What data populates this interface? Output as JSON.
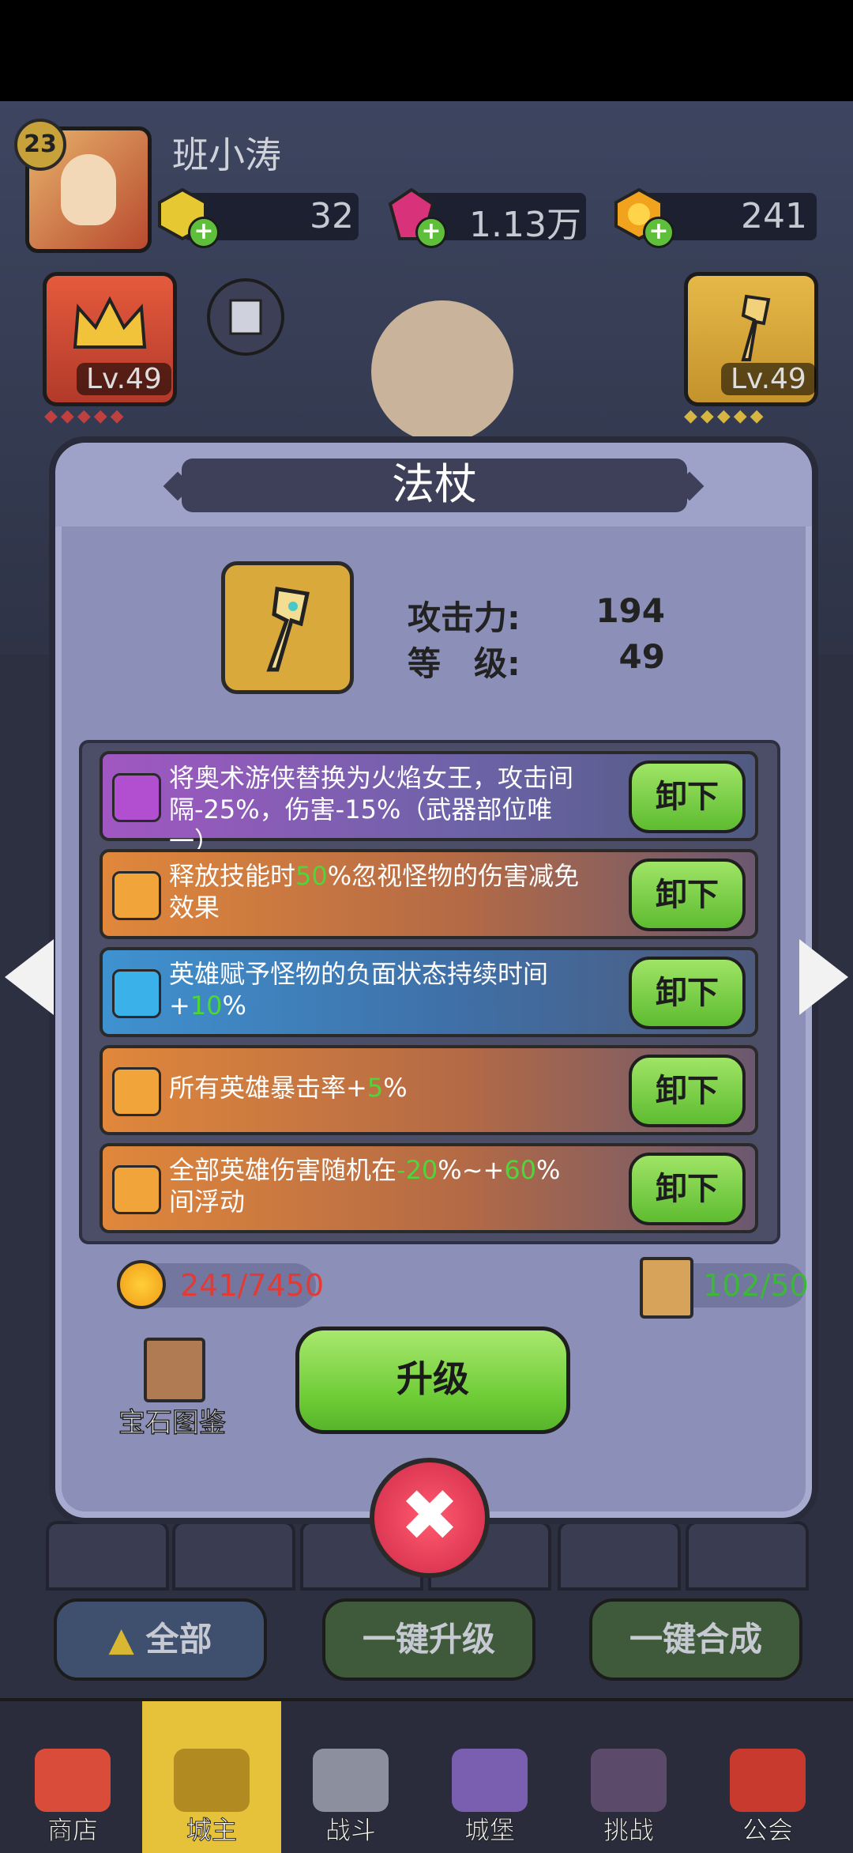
{
  "player": {
    "level": "23",
    "name": "班小涛",
    "resources": [
      {
        "icon": "gold-gem-icon",
        "value": "32"
      },
      {
        "icon": "pink-crystal-icon",
        "value": "1.13万"
      },
      {
        "icon": "gold-coin-icon",
        "value": "241"
      }
    ]
  },
  "side_slots": {
    "left": {
      "icon": "crown-icon",
      "level": "Lv.49"
    },
    "right": {
      "icon": "staff-icon",
      "level": "Lv.49"
    }
  },
  "modal": {
    "title": "法杖",
    "weapon_icon": "staff-icon",
    "stats": [
      {
        "label": "攻击力:",
        "value": "194"
      },
      {
        "label": "等　级:",
        "value": "49"
      }
    ],
    "gems": [
      {
        "color": "purple",
        "icon": "arcane-gem-icon",
        "text_parts": [
          {
            "t": "将奥术游侠替换为火焰女王，攻击间隔-25%，伤害-15%（武器部位唯一）",
            "hl": false
          }
        ],
        "button": "卸下"
      },
      {
        "color": "orange",
        "icon": "swirl-gem-icon",
        "text_parts": [
          {
            "t": "释放技能时",
            "hl": false
          },
          {
            "t": "50",
            "hl": true
          },
          {
            "t": "%忽视怪物的伤害减免效果",
            "hl": false
          }
        ],
        "button": "卸下"
      },
      {
        "color": "blue",
        "icon": "blue-swirl-gem-icon",
        "text_parts": [
          {
            "t": "英雄赋予怪物的负面状态持续时间+",
            "hl": false
          },
          {
            "t": "10",
            "hl": true
          },
          {
            "t": "%",
            "hl": false
          }
        ],
        "button": "卸下"
      },
      {
        "color": "orange",
        "icon": "hexagon-gem-icon",
        "text_parts": [
          {
            "t": "所有英雄暴击率+",
            "hl": false
          },
          {
            "t": "5",
            "hl": true
          },
          {
            "t": "%",
            "hl": false
          }
        ],
        "button": "卸下"
      },
      {
        "color": "orange",
        "icon": "swirl-gem-icon",
        "text_parts": [
          {
            "t": "全部英雄伤害随机在",
            "hl": false
          },
          {
            "t": "-20",
            "hl": true
          },
          {
            "t": "%~+",
            "hl": false
          },
          {
            "t": "60",
            "hl": true
          },
          {
            "t": "%间浮动",
            "hl": false
          }
        ],
        "button": "卸下"
      }
    ],
    "coin_cost": "241/7450",
    "scroll_cost": "102/50",
    "gem_book_label": "宝石图鉴",
    "upgrade_label": "升级",
    "close_symbol": "✖"
  },
  "bottom_buttons": {
    "all": "全部",
    "upgrade_all": "一键升级",
    "merge_all": "一键合成"
  },
  "nav": [
    {
      "label": "商店",
      "icon": "shop-icon",
      "active": false
    },
    {
      "label": "城主",
      "icon": "crown-icon",
      "active": true
    },
    {
      "label": "战斗",
      "icon": "crossed-swords-icon",
      "active": false
    },
    {
      "label": "城堡",
      "icon": "castle-icon",
      "active": false
    },
    {
      "label": "挑战",
      "icon": "demon-icon",
      "active": false
    },
    {
      "label": "公会",
      "icon": "guild-banner-icon",
      "active": false
    }
  ],
  "colors": {
    "highlight_green": "#4cd63a",
    "cost_red": "#e23a35",
    "button_green": "#6ccb35",
    "modal_bg": "#8c8fb8"
  }
}
